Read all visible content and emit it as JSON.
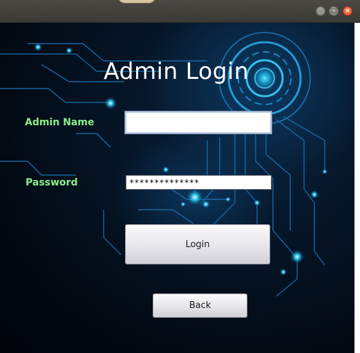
{
  "window": {
    "title": "",
    "buttons": {
      "minimize_icon": "minimize-icon",
      "maximize_icon": "maximize-icon",
      "close_icon": "close-icon"
    }
  },
  "form": {
    "heading": "Admin Login",
    "admin_name_label": "Admin Name",
    "admin_name_value": "",
    "password_label": "Password",
    "password_value": "**************",
    "login_button": "Login",
    "back_button": "Back"
  },
  "colors": {
    "label": "#8cf08a",
    "heading": "#ffffff",
    "background": "#020a14",
    "circuit_glow": "#1fc4ff"
  }
}
